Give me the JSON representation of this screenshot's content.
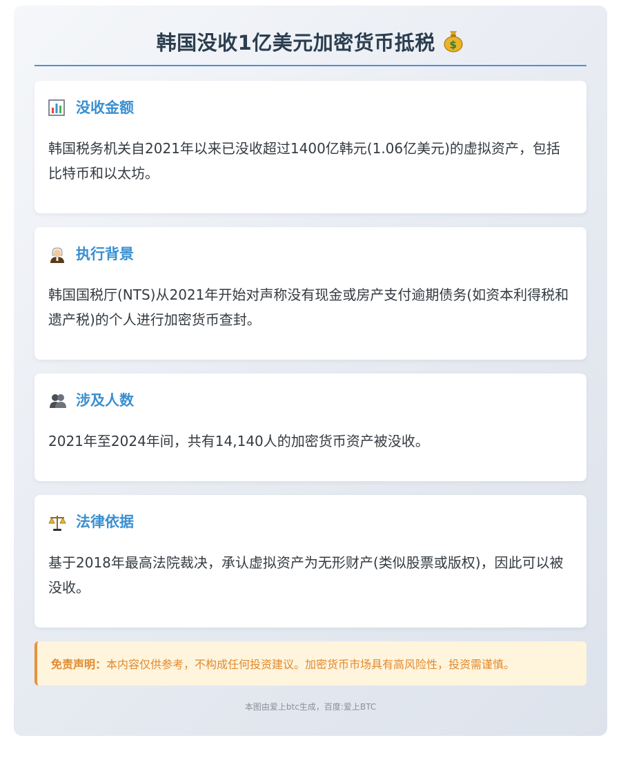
{
  "header": {
    "title": "韩国没收1亿美元加密货币抵税",
    "title_icon": "money-bag-icon"
  },
  "cards": [
    {
      "icon": "bar-chart-icon",
      "title": "没收金额",
      "body": "韩国税务机关自2021年以来已没收超过1400亿韩元(1.06亿美元)的虚拟资产，包括比特币和以太坊。"
    },
    {
      "icon": "judge-icon",
      "title": "执行背景",
      "body": "韩国国税厅(NTS)从2021年开始对声称没有现金或房产支付逾期债务(如资本利得税和遗产税)的个人进行加密货币查封。"
    },
    {
      "icon": "people-icon",
      "title": "涉及人数",
      "body": "2021年至2024年间，共有14,140人的加密货币资产被没收。"
    },
    {
      "icon": "scales-icon",
      "title": "法律依据",
      "body": "基于2018年最高法院裁决，承认虚拟资产为无形财产(类似股票或版权)，因此可以被没收。"
    }
  ],
  "disclaimer": {
    "label": "免责声明：",
    "text": "本内容仅供参考，不构成任何投资建议。加密货币市场具有高风险性，投资需谨慎。"
  },
  "footer": {
    "text": "本图由爱上btc生成，百度:爱上BTC"
  },
  "colors": {
    "accent": "#3a8fd0",
    "title": "#2c3e50",
    "disclaimer_bg": "#fff4dc",
    "disclaimer_text": "#e08a2e"
  }
}
